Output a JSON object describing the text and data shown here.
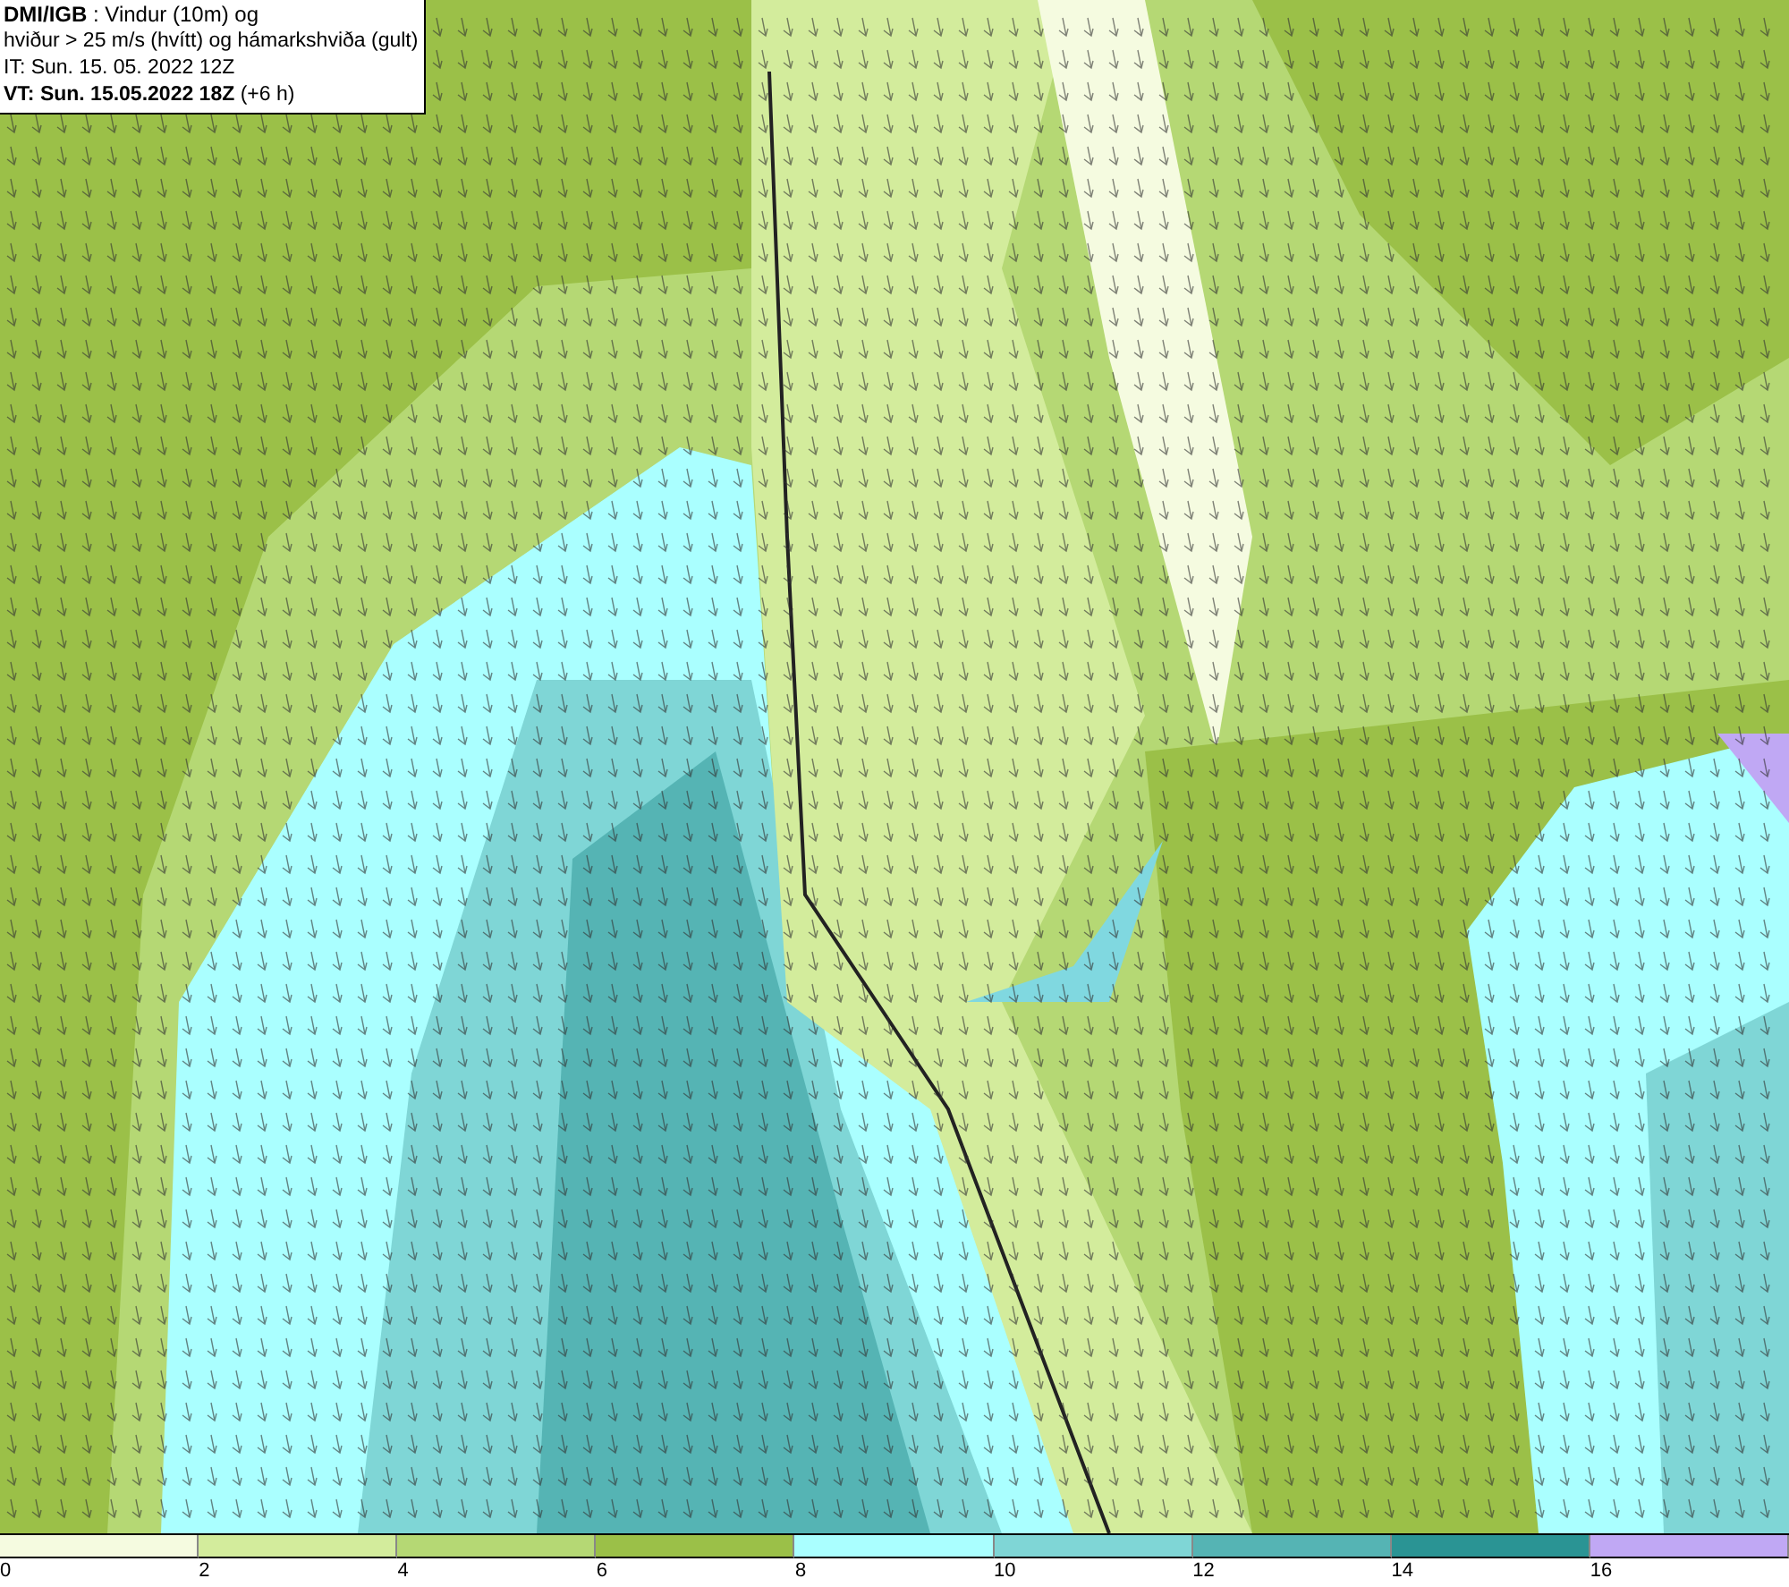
{
  "header": {
    "lines": [
      "**DMI/IGB** : Vindur (10m) og",
      "hviður > 25 m/s (hvítt) og hámarkshviða (gult)",
      "IT: Sun. 15. 05. 2022 12Z",
      "**VT: Sun. 15.05.2022 18Z** (+6 h)"
    ]
  },
  "legend": [
    {
      "color": "#f5fbe0",
      "label": "0"
    },
    {
      "color": "#d3ec9c",
      "label": "2"
    },
    {
      "color": "#b5d874",
      "label": "4"
    },
    {
      "color": "#9bc048",
      "label": "6"
    },
    {
      "color": "#aaffff",
      "label": "8"
    },
    {
      "color": "#7fd6d6",
      "label": "10"
    },
    {
      "color": "#55b4b4",
      "label": "12"
    },
    {
      "color": "#2a9494",
      "label": "14"
    },
    {
      "color": "#c0a8f4",
      "label": "16"
    }
  ]
}
